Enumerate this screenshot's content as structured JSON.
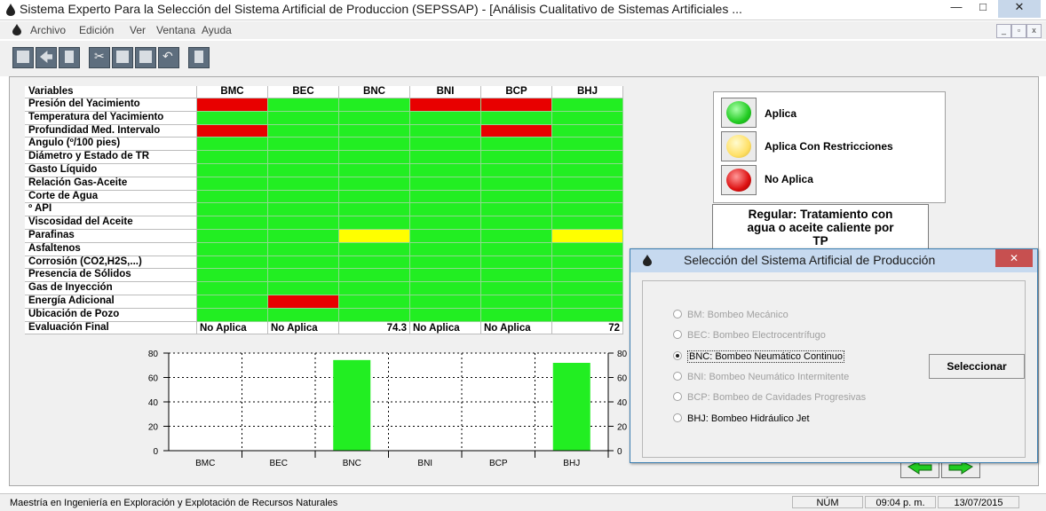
{
  "window": {
    "title": "Sistema Experto Para la Selección del Sistema Artificial de Produccion (SEPSSAP) - [Análisis Cualitativo de Sistemas Artificiales ...",
    "minimize": "—",
    "maximize": "□",
    "close": "✕"
  },
  "menu": {
    "items": [
      "Archivo",
      "Edición",
      "Ver",
      "Ventana",
      "Ayuda"
    ],
    "mdi_minimize": "_",
    "mdi_restore": "▫",
    "mdi_close": "x"
  },
  "toolbar": {
    "icons": [
      "new-icon",
      "open-icon",
      "save-icon",
      "cut-icon",
      "copy-icon",
      "paste-icon",
      "undo-icon",
      "exit-icon"
    ]
  },
  "grid": {
    "header_label": "Variables",
    "systems": [
      "BMC",
      "BEC",
      "BNC",
      "BNI",
      "BCP",
      "BHJ"
    ],
    "rows": [
      {
        "label": "Presión del Yacimiento",
        "status": [
          "N",
          "A",
          "A",
          "N",
          "N",
          "A"
        ]
      },
      {
        "label": "Temperatura del Yacimiento",
        "status": [
          "A",
          "A",
          "A",
          "A",
          "A",
          "A"
        ]
      },
      {
        "label": "Profundidad Med. Intervalo",
        "status": [
          "N",
          "A",
          "A",
          "A",
          "N",
          "A"
        ]
      },
      {
        "label": "Angulo (º/100 pies)",
        "status": [
          "A",
          "A",
          "A",
          "A",
          "A",
          "A"
        ]
      },
      {
        "label": "Diámetro y Estado de TR",
        "status": [
          "A",
          "A",
          "A",
          "A",
          "A",
          "A"
        ]
      },
      {
        "label": "Gasto Líquido",
        "status": [
          "A",
          "A",
          "A",
          "A",
          "A",
          "A"
        ]
      },
      {
        "label": "Relación Gas-Aceite",
        "status": [
          "A",
          "A",
          "A",
          "A",
          "A",
          "A"
        ]
      },
      {
        "label": "Corte de Agua",
        "status": [
          "A",
          "A",
          "A",
          "A",
          "A",
          "A"
        ]
      },
      {
        "label": "º API",
        "status": [
          "A",
          "A",
          "A",
          "A",
          "A",
          "A"
        ]
      },
      {
        "label": "Viscosidad del Aceite",
        "status": [
          "A",
          "A",
          "A",
          "A",
          "A",
          "A"
        ]
      },
      {
        "label": "Parafinas",
        "status": [
          "A",
          "A",
          "R",
          "A",
          "A",
          "R"
        ]
      },
      {
        "label": "Asfaltenos",
        "status": [
          "A",
          "A",
          "A",
          "A",
          "A",
          "A"
        ]
      },
      {
        "label": "Corrosión (CO2,H2S,...)",
        "status": [
          "A",
          "A",
          "A",
          "A",
          "A",
          "A"
        ]
      },
      {
        "label": "Presencia de Sólidos",
        "status": [
          "A",
          "A",
          "A",
          "A",
          "A",
          "A"
        ]
      },
      {
        "label": "Gas de Inyección",
        "status": [
          "A",
          "A",
          "A",
          "A",
          "A",
          "A"
        ]
      },
      {
        "label": "Energía Adicional",
        "status": [
          "A",
          "N",
          "A",
          "A",
          "A",
          "A"
        ]
      },
      {
        "label": "Ubicación de Pozo",
        "status": [
          "A",
          "A",
          "A",
          "A",
          "A",
          "A"
        ]
      }
    ],
    "final_label": "Evaluación Final",
    "final_values": [
      "No Aplica",
      "No Aplica",
      "74.3",
      "No Aplica",
      "No Aplica",
      "72"
    ],
    "colors": {
      "A": "#22ee22",
      "N": "#e80000",
      "R": "#ffff00"
    }
  },
  "legend": {
    "items": [
      {
        "label": "Aplica",
        "color": "#22dd22"
      },
      {
        "label": "Aplica Con Restricciones",
        "color": "#ffee66"
      },
      {
        "label": "No Aplica",
        "color": "#dd1111"
      }
    ]
  },
  "recommendation": {
    "lines": [
      "Regular: Tratamiento con",
      "agua o aceite caliente por",
      "TP"
    ]
  },
  "chart_data": {
    "type": "bar",
    "categories": [
      "BMC",
      "BEC",
      "BNC",
      "BNI",
      "BCP",
      "BHJ"
    ],
    "values": [
      0,
      0,
      74.3,
      0,
      0,
      72
    ],
    "ylim": [
      0,
      80
    ],
    "yticks": [
      0,
      20,
      40,
      60,
      80
    ],
    "bar_color": "#22ee22",
    "grid": "dotted-vertical"
  },
  "dialog": {
    "title": "Selección del Sistema Artificial de Producción",
    "close": "✕",
    "options": [
      {
        "label": "BM: Bombeo Mecánico",
        "enabled": false,
        "checked": false
      },
      {
        "label": "BEC: Bombeo Electrocentrífugo",
        "enabled": false,
        "checked": false
      },
      {
        "label": "BNC: Bombeo Neumático Continuo",
        "enabled": true,
        "checked": true
      },
      {
        "label": "BNI: Bombeo Neumático Intermitente",
        "enabled": false,
        "checked": false
      },
      {
        "label": "BCP: Bombeo de Cavidades Progresivas",
        "enabled": false,
        "checked": false
      },
      {
        "label": "BHJ: Bombeo Hidráulico Jet",
        "enabled": true,
        "checked": false
      }
    ],
    "select_button": "Seleccionar"
  },
  "statusbar": {
    "text": "Maestría en Ingeniería en Exploración y Explotación de Recursos Naturales",
    "num": "NÚM",
    "time": "09:04 p. m.",
    "date": "13/07/2015"
  }
}
